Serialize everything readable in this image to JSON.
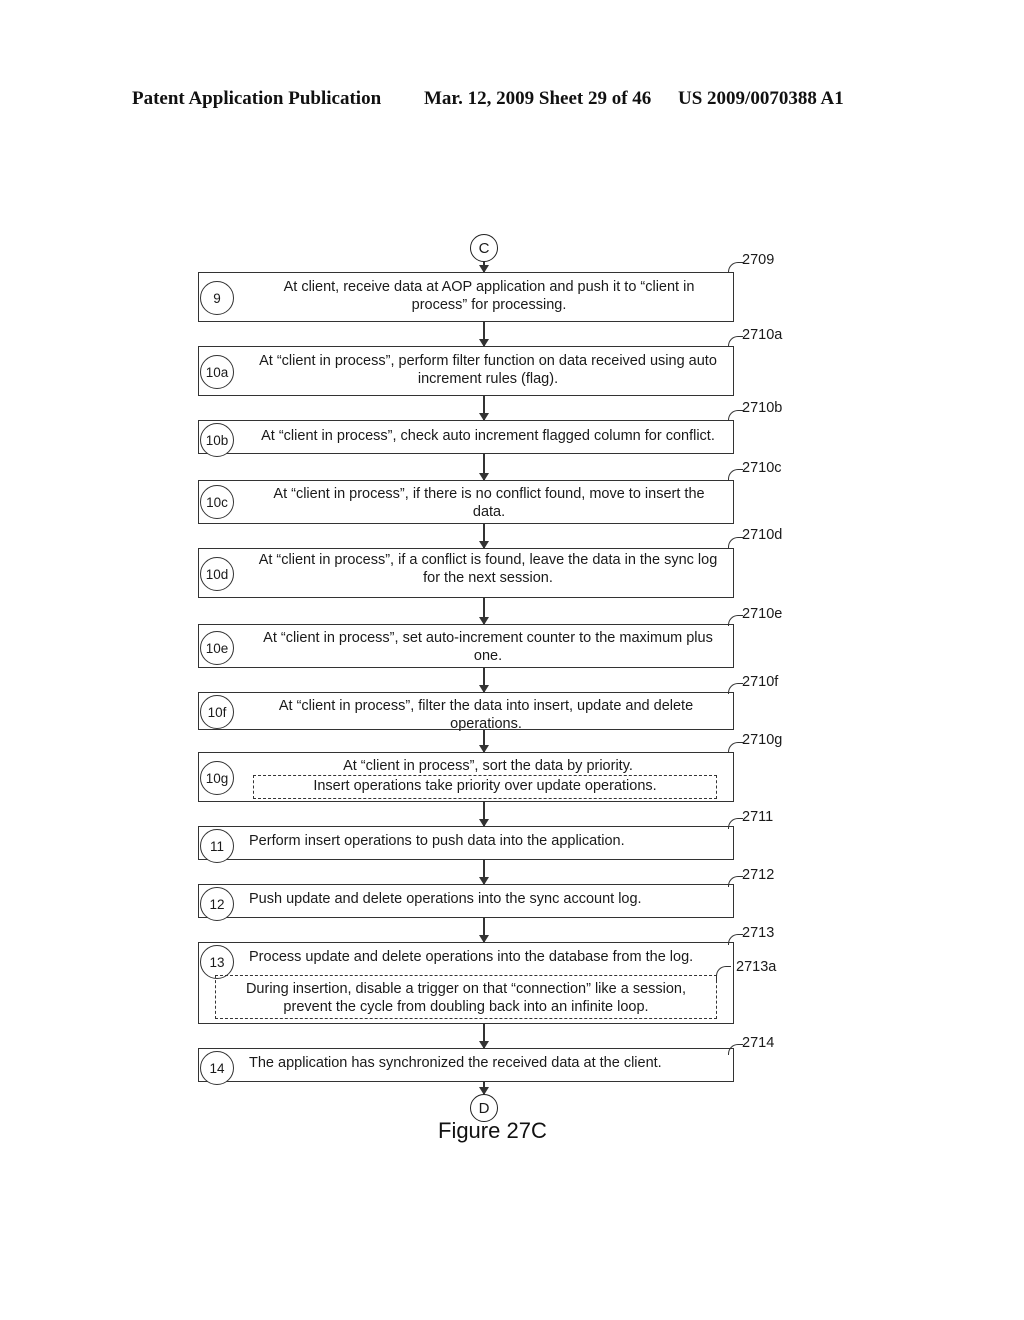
{
  "header": {
    "left": "Patent Application Publication",
    "middle": "Mar. 12, 2009  Sheet 29 of 46",
    "right": "US 2009/0070388 A1"
  },
  "connectors": {
    "top": "C",
    "bottom": "D"
  },
  "steps": [
    {
      "badge": "9",
      "ref": "2709",
      "text": "At client, receive data at AOP application and push it to “client in process” for processing."
    },
    {
      "badge": "10a",
      "ref": "2710a",
      "text": "At “client in process”, perform filter function on data received using auto increment rules (flag)."
    },
    {
      "badge": "10b",
      "ref": "2710b",
      "text": "At “client in process”, check auto increment flagged column for conflict."
    },
    {
      "badge": "10c",
      "ref": "2710c",
      "text": "At “client in process”, if there is no conflict found, move to insert the data."
    },
    {
      "badge": "10d",
      "ref": "2710d",
      "text": "At “client in process”, if a conflict is found, leave the data in the sync log for the next session."
    },
    {
      "badge": "10e",
      "ref": "2710e",
      "text": "At “client in process”, set auto-increment counter to the maximum plus one."
    },
    {
      "badge": "10f",
      "ref": "2710f",
      "text": "At “client in process”, filter the data into insert, update and delete operations."
    },
    {
      "badge": "10g",
      "ref": "2710g",
      "text": "At “client in process”, sort the data by priority.",
      "sub": "Insert operations take priority over update operations."
    },
    {
      "badge": "11",
      "ref": "2711",
      "text": "Perform insert operations to push data into the application."
    },
    {
      "badge": "12",
      "ref": "2712",
      "text": "Push update and delete operations into the sync account log."
    },
    {
      "badge": "13",
      "ref": "2713",
      "text": "Process update and delete operations into the database from the log.",
      "sub": "During insertion, disable a trigger on that “connection” like a session, prevent the cycle from doubling back into an infinite loop.",
      "sub_ref": "2713a"
    },
    {
      "badge": "14",
      "ref": "2714",
      "text": "The application has synchronized the received data at the client."
    }
  ],
  "caption": "Figure 27C"
}
